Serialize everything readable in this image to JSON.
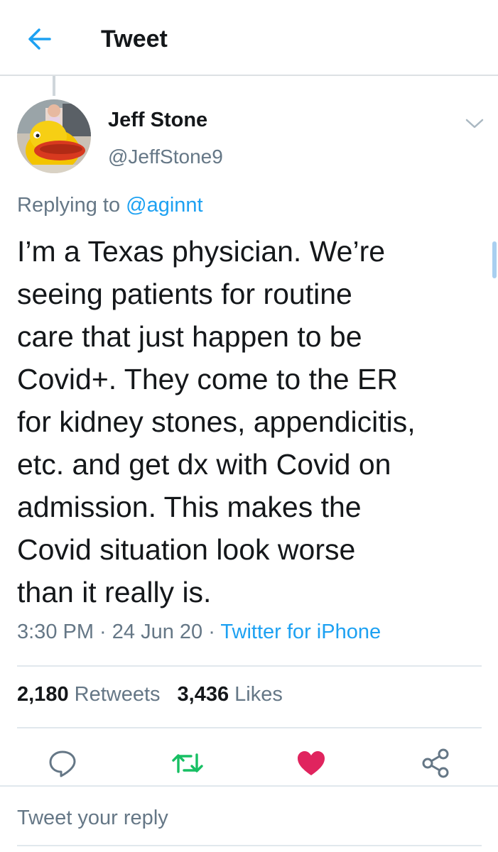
{
  "header": {
    "title": "Tweet",
    "back_icon": "arrow-left-icon"
  },
  "tweet": {
    "author_name": "Jeff Stone",
    "author_handle": "@JeffStone9",
    "replying_prefix": "Replying to ",
    "replying_to": "@aginnt",
    "text": "I’m a Texas physician. We’re\nseeing patients for routine\ncare that just happen to be\nCovid+. They come to the ER\nfor kidney stones, appendicitis,\netc. and get dx with Covid on\nadmission. This makes the\nCovid situation look worse\nthan it really is.",
    "time": "3:30 PM",
    "separator": " · ",
    "date": "24 Jun 20",
    "source": "Twitter for iPhone"
  },
  "stats": {
    "retweets_count": "2,180",
    "retweets_label": " Retweets",
    "likes_count": "3,436",
    "likes_label": " Likes"
  },
  "actions": [
    {
      "icon": "reply-icon",
      "color": "#657786"
    },
    {
      "icon": "retweet-icon",
      "color": "#17bf63"
    },
    {
      "icon": "heart-icon",
      "color": "#e0245e"
    },
    {
      "icon": "share-icon",
      "color": "#657786"
    }
  ],
  "reply_box": {
    "placeholder": "Tweet your reply"
  },
  "colors": {
    "accent": "#1da1f2",
    "secondary_text": "#657786",
    "like": "#e0245e",
    "retweet": "#17bf63"
  }
}
